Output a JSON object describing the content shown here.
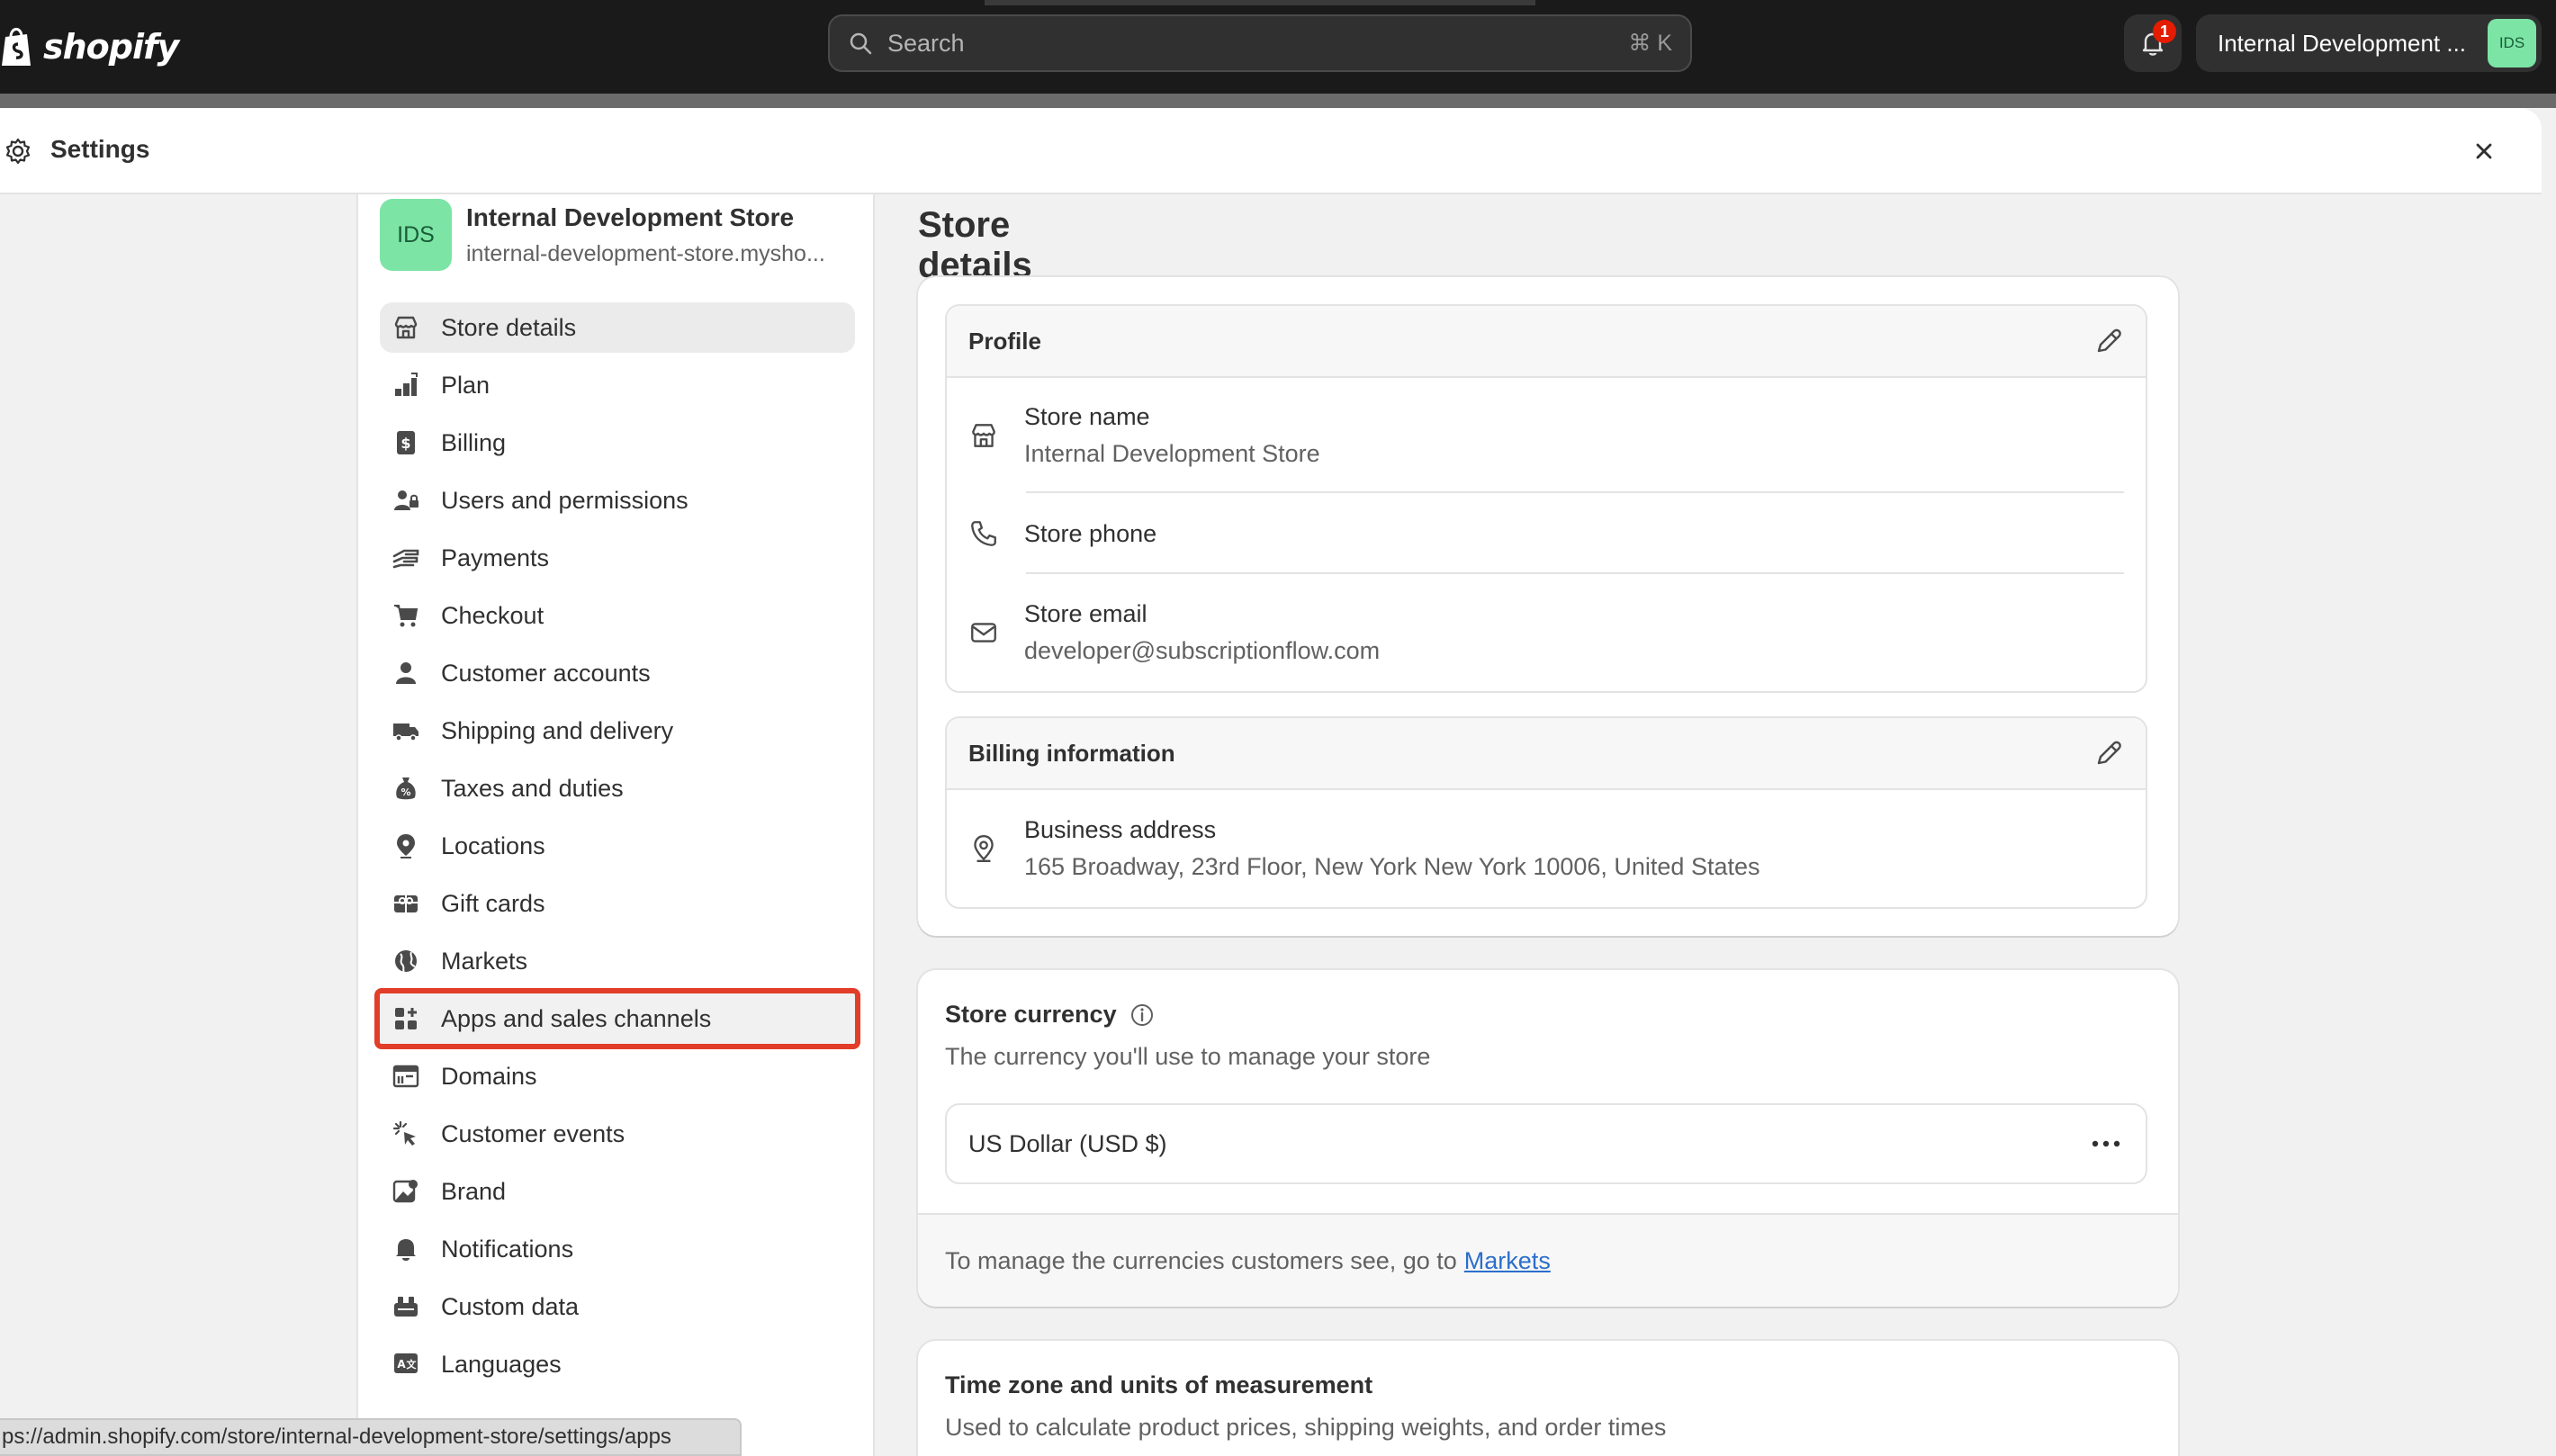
{
  "topbar": {
    "logo_text": "shopify",
    "search_placeholder": "Search",
    "search_shortcut": "⌘ K",
    "notification_count": "1",
    "store_switch_name": "Internal Development ...",
    "store_switch_avatar": "IDS"
  },
  "panel": {
    "title": "Settings",
    "close_icon": "close-icon"
  },
  "store": {
    "avatar": "IDS",
    "name": "Internal Development Store",
    "domain": "internal-development-store.mysho..."
  },
  "sidebar": {
    "items": [
      {
        "label": "Store details",
        "icon": "store-icon",
        "active": true
      },
      {
        "label": "Plan",
        "icon": "plan-icon"
      },
      {
        "label": "Billing",
        "icon": "billing-icon"
      },
      {
        "label": "Users and permissions",
        "icon": "users-icon"
      },
      {
        "label": "Payments",
        "icon": "payments-icon"
      },
      {
        "label": "Checkout",
        "icon": "cart-icon"
      },
      {
        "label": "Customer accounts",
        "icon": "person-icon"
      },
      {
        "label": "Shipping and delivery",
        "icon": "truck-icon"
      },
      {
        "label": "Taxes and duties",
        "icon": "tax-icon"
      },
      {
        "label": "Locations",
        "icon": "location-icon"
      },
      {
        "label": "Gift cards",
        "icon": "gift-card-icon"
      },
      {
        "label": "Markets",
        "icon": "globe-icon"
      },
      {
        "label": "Apps and sales channels",
        "icon": "apps-icon",
        "highlighted": true
      },
      {
        "label": "Domains",
        "icon": "domains-icon"
      },
      {
        "label": "Customer events",
        "icon": "cursor-icon"
      },
      {
        "label": "Brand",
        "icon": "brand-icon"
      },
      {
        "label": "Notifications",
        "icon": "bell-icon"
      },
      {
        "label": "Custom data",
        "icon": "custom-data-icon"
      },
      {
        "label": "Languages",
        "icon": "language-icon"
      }
    ]
  },
  "main": {
    "page_title": "Store details",
    "profile": {
      "title": "Profile",
      "store_name_label": "Store name",
      "store_name_value": "Internal Development Store",
      "store_phone_label": "Store phone",
      "store_email_label": "Store email",
      "store_email_value": "developer@subscriptionflow.com"
    },
    "billing": {
      "title": "Billing information",
      "address_label": "Business address",
      "address_value": "165 Broadway, 23rd Floor, New York New York 10006, United States"
    },
    "currency": {
      "title": "Store currency",
      "subtitle": "The currency you'll use to manage your store",
      "value": "US Dollar (USD $)",
      "footer_text": "To manage the currencies customers see, go to",
      "footer_link": "Markets"
    },
    "timezone": {
      "title": "Time zone and units of measurement",
      "subtitle": "Used to calculate product prices, shipping weights, and order times"
    }
  },
  "status_bar": {
    "url": "ps://admin.shopify.com/store/internal-development-store/settings/apps"
  },
  "colors": {
    "topbar": "#1a1a1a",
    "highlight_outline": "#e23d28",
    "avatar_green": "#7ce4a5",
    "link_blue": "#2c6ecb"
  }
}
